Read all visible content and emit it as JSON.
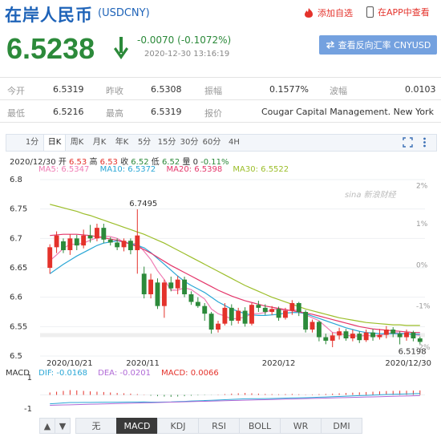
{
  "header": {
    "title": "在岸人民币",
    "code": "(USDCNY)",
    "add_watch": "添加自选",
    "app_view": "在APP中查看"
  },
  "quote": {
    "price": "6.5238",
    "change": "-0.0070 (-0.1072%)",
    "datetime": "2020-12-30 13:16:19",
    "reverse_button": "查看反向汇率 CNYUSD"
  },
  "stats": {
    "row1": {
      "open_label": "今开",
      "open": "6.5319",
      "prev_label": "昨收",
      "prev": "6.5308",
      "amp_label": "振幅",
      "amp": "0.1577%",
      "wave_label": "波幅",
      "wave": "0.0103"
    },
    "row2": {
      "low_label": "最低",
      "low": "6.5216",
      "high_label": "最高",
      "high": "6.5319",
      "quote_label": "报价",
      "quote": "Cougar Capital Management. New York"
    }
  },
  "tabs": [
    "1分",
    "日K",
    "周K",
    "月K",
    "年K",
    "5分",
    "15分",
    "30分",
    "60分",
    "4H"
  ],
  "active_tab": "日K",
  "ohlc": {
    "date": "2020/12/30",
    "open_label": "开",
    "open": "6.53",
    "high_label": "高",
    "high": "6.53",
    "close_label": "收",
    "close": "6.52",
    "low_label": "低",
    "low": "6.52",
    "vol_label": "量",
    "vol": "0",
    "pct": "-0.11%"
  },
  "ma": {
    "ma5": "MA5: 6.5347",
    "ma10": "MA10: 6.5372",
    "ma20": "MA20: 6.5398",
    "ma30": "MA30: 6.5522"
  },
  "colors": {
    "up": "#e4322b",
    "down": "#2c8a3a",
    "ma5": "#f07cb4",
    "ma10": "#2aa7d6",
    "ma20": "#e4366a",
    "ma30": "#9cbe2a",
    "accent": "#1e63b8"
  },
  "watermark": "sina 新浪财经",
  "chart_data": {
    "type": "candlestick",
    "ylim": [
      6.5,
      6.8
    ],
    "y_ticks": [
      "6.8",
      "6.75",
      "6.7",
      "6.65",
      "6.6",
      "6.55",
      "6.5"
    ],
    "pct_ticks": [
      "2%",
      "1%",
      "0%",
      "-1%",
      "-2%"
    ],
    "x_labels": [
      "2020/10/21",
      "2020/11",
      "2020/12",
      "2020/12/30"
    ],
    "max_label": "6.7495",
    "min_label": "6.5198",
    "candles": [
      [
        6.65,
        6.685,
        6.64,
        6.69
      ],
      [
        6.685,
        6.705,
        6.675,
        6.712
      ],
      [
        6.695,
        6.68,
        6.675,
        6.7
      ],
      [
        6.68,
        6.7,
        6.672,
        6.707
      ],
      [
        6.7,
        6.688,
        6.68,
        6.706
      ],
      [
        6.688,
        6.705,
        6.683,
        6.715
      ],
      [
        6.705,
        6.7,
        6.693,
        6.723
      ],
      [
        6.7,
        6.718,
        6.695,
        6.725
      ],
      [
        6.718,
        6.698,
        6.692,
        6.725
      ],
      [
        6.698,
        6.693,
        6.688,
        6.702
      ],
      [
        6.693,
        6.685,
        6.68,
        6.7
      ],
      [
        6.685,
        6.696,
        6.678,
        6.7
      ],
      [
        6.696,
        6.68,
        6.673,
        6.7
      ],
      [
        6.68,
        6.705,
        6.64,
        6.7495
      ],
      [
        6.64,
        6.605,
        6.598,
        6.652
      ],
      [
        6.605,
        6.63,
        6.598,
        6.64
      ],
      [
        6.625,
        6.585,
        6.58,
        6.632
      ],
      [
        6.585,
        6.625,
        6.565,
        6.63
      ],
      [
        6.625,
        6.615,
        6.61,
        6.635
      ],
      [
        6.615,
        6.63,
        6.605,
        6.636
      ],
      [
        6.63,
        6.605,
        6.6,
        6.635
      ],
      [
        6.605,
        6.592,
        6.587,
        6.61
      ],
      [
        6.592,
        6.585,
        6.582,
        6.6
      ],
      [
        6.585,
        6.572,
        6.56,
        6.59
      ],
      [
        6.572,
        6.545,
        6.538,
        6.575
      ],
      [
        6.545,
        6.555,
        6.54,
        6.56
      ],
      [
        6.555,
        6.582,
        6.552,
        6.59
      ],
      [
        6.582,
        6.56,
        6.552,
        6.588
      ],
      [
        6.56,
        6.577,
        6.555,
        6.582
      ],
      [
        6.577,
        6.555,
        6.55,
        6.583
      ],
      [
        6.555,
        6.587,
        6.552,
        6.59
      ],
      [
        6.587,
        6.582,
        6.575,
        6.594
      ],
      [
        6.582,
        6.575,
        6.57,
        6.588
      ],
      [
        6.575,
        6.58,
        6.57,
        6.585
      ],
      [
        6.58,
        6.565,
        6.56,
        6.584
      ],
      [
        6.565,
        6.577,
        6.562,
        6.582
      ],
      [
        6.577,
        6.59,
        6.57,
        6.595
      ],
      [
        6.59,
        6.575,
        6.568,
        6.592
      ],
      [
        6.575,
        6.545,
        6.54,
        6.578
      ],
      [
        6.545,
        6.558,
        6.54,
        6.562
      ],
      [
        6.558,
        6.532,
        6.525,
        6.56
      ],
      [
        6.532,
        6.526,
        6.52,
        6.538
      ],
      [
        6.526,
        6.535,
        6.515,
        6.54
      ],
      [
        6.535,
        6.542,
        6.528,
        6.548
      ],
      [
        6.542,
        6.53,
        6.526,
        6.546
      ],
      [
        6.53,
        6.538,
        6.525,
        6.545
      ],
      [
        6.538,
        6.527,
        6.522,
        6.542
      ],
      [
        6.527,
        6.54,
        6.524,
        6.545
      ],
      [
        6.54,
        6.532,
        6.526,
        6.546
      ],
      [
        6.532,
        6.536,
        6.528,
        6.546
      ],
      [
        6.536,
        6.545,
        6.53,
        6.551
      ],
      [
        6.545,
        6.538,
        6.532,
        6.549
      ],
      [
        6.538,
        6.532,
        6.5198,
        6.542
      ],
      [
        6.532,
        6.54,
        6.526,
        6.545
      ],
      [
        6.54,
        6.53,
        6.525,
        6.543
      ],
      [
        6.53,
        6.524,
        6.52,
        6.533
      ]
    ],
    "ma_series": {
      "ma5": [
        6.662,
        6.672,
        6.683,
        6.69,
        6.69,
        6.692,
        6.697,
        6.701,
        6.704,
        6.703,
        6.7,
        6.694,
        6.69,
        6.692,
        6.678,
        6.664,
        6.645,
        6.63,
        6.612,
        6.612,
        6.616,
        6.613,
        6.605,
        6.597,
        6.58,
        6.572,
        6.568,
        6.563,
        6.564,
        6.566,
        6.572,
        6.572,
        6.574,
        6.579,
        6.58,
        6.577,
        6.578,
        6.578,
        6.57,
        6.565,
        6.56,
        6.55,
        6.54,
        6.539,
        6.535,
        6.534,
        6.534,
        6.535,
        6.534,
        6.535,
        6.538,
        6.54,
        6.539,
        6.538,
        6.537,
        6.535
      ],
      "ma10": [
        6.64,
        6.648,
        6.656,
        6.663,
        6.67,
        6.676,
        6.682,
        6.688,
        6.692,
        6.694,
        6.696,
        6.694,
        6.691,
        6.688,
        6.684,
        6.676,
        6.666,
        6.656,
        6.646,
        6.636,
        6.627,
        6.62,
        6.614,
        6.608,
        6.6,
        6.592,
        6.586,
        6.58,
        6.576,
        6.572,
        6.57,
        6.569,
        6.569,
        6.57,
        6.571,
        6.573,
        6.574,
        6.574,
        6.572,
        6.568,
        6.564,
        6.56,
        6.556,
        6.552,
        6.548,
        6.545,
        6.542,
        6.54,
        6.539,
        6.538,
        6.538,
        6.538,
        6.538,
        6.538,
        6.537,
        6.537
      ],
      "ma20": [
        6.705,
        6.706,
        6.707,
        6.707,
        6.707,
        6.706,
        6.705,
        6.703,
        6.701,
        6.699,
        6.697,
        6.694,
        6.69,
        6.686,
        6.681,
        6.675,
        6.668,
        6.661,
        6.654,
        6.648,
        6.642,
        6.636,
        6.63,
        6.624,
        6.618,
        6.612,
        6.607,
        6.602,
        6.598,
        6.594,
        6.591,
        6.588,
        6.585,
        6.583,
        6.581,
        6.579,
        6.577,
        6.575,
        6.573,
        6.571,
        6.568,
        6.565,
        6.562,
        6.559,
        6.556,
        6.553,
        6.55,
        6.548,
        6.546,
        6.545,
        6.544,
        6.543,
        6.542,
        6.541,
        6.54,
        6.54
      ],
      "ma30": [
        6.758,
        6.755,
        6.752,
        6.749,
        6.746,
        6.742,
        6.739,
        6.735,
        6.731,
        6.727,
        6.723,
        6.719,
        6.715,
        6.711,
        6.707,
        6.702,
        6.697,
        6.692,
        6.686,
        6.68,
        6.674,
        6.668,
        6.662,
        6.656,
        6.65,
        6.644,
        6.638,
        6.632,
        6.626,
        6.62,
        6.615,
        6.61,
        6.605,
        6.6,
        6.596,
        6.592,
        6.588,
        6.584,
        6.58,
        6.577,
        6.574,
        6.571,
        6.568,
        6.565,
        6.563,
        6.561,
        6.559,
        6.557,
        6.556,
        6.555,
        6.554,
        6.553,
        6.553,
        6.552,
        6.552,
        6.552
      ]
    }
  },
  "macd": {
    "label": "MACD",
    "dif": "DIF: -0.0168",
    "dea": "DEA: -0.0201",
    "macd": "MACD: 0.0066",
    "y_ticks": [
      "1",
      "-1"
    ],
    "hist": [
      0.15,
      0.2,
      0.25,
      0.3,
      0.28,
      0.25,
      0.22,
      0.2,
      0.18,
      0.15,
      0.12,
      0.1,
      0.08,
      0.05,
      0.02,
      -0.05,
      -0.08,
      -0.1,
      -0.12,
      -0.1,
      -0.08,
      -0.05,
      -0.03,
      -0.02,
      -0.01,
      0.02,
      0.05,
      0.08,
      0.1,
      0.12,
      0.1,
      0.08,
      0.06,
      0.05,
      0.04,
      0.05,
      0.06,
      0.04,
      0.02,
      0.03,
      0.05,
      0.06,
      0.08,
      0.1,
      0.12,
      0.14,
      0.16,
      0.18,
      0.2,
      0.22,
      0.24,
      0.25,
      0.26,
      0.26,
      0.27,
      0.28
    ]
  },
  "indicator_tabs": [
    "无",
    "MACD",
    "KDJ",
    "RSI",
    "BOLL",
    "WR",
    "DMI"
  ],
  "active_indicator": "MACD",
  "nav": {
    "up": "▲",
    "down": "▼"
  }
}
